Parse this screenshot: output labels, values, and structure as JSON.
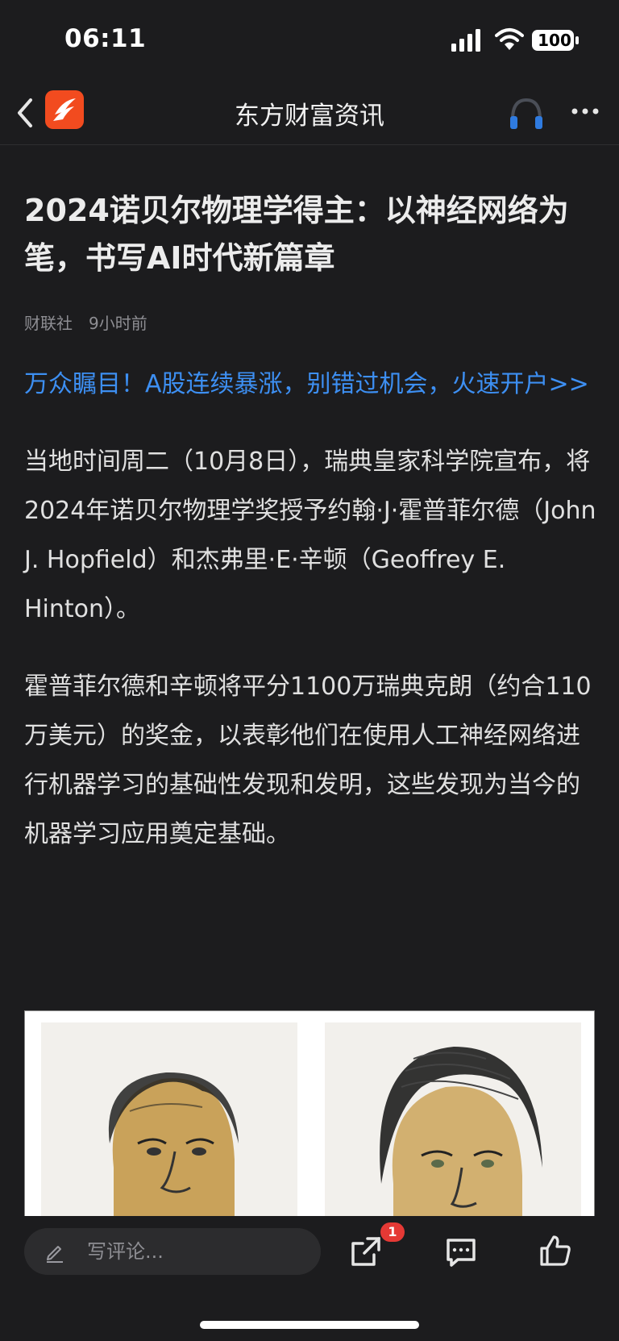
{
  "status_bar": {
    "time": "06:11",
    "battery": "100",
    "icons": [
      "signal-icon",
      "wifi-icon",
      "battery-icon"
    ]
  },
  "nav": {
    "title": "东方财富资讯",
    "icons": [
      "back-icon",
      "app-logo-icon",
      "headset-icon",
      "more-icon"
    ]
  },
  "article": {
    "title": "2024诺贝尔物理学得主：以神经网络为笔，书写AI时代新篇章",
    "source": "财联社",
    "time": "9小时前",
    "promo": "万众瞩目！A股连续暴涨，别错过机会，火速开户>>",
    "paragraphs": [
      "当地时间周二（10月8日），瑞典皇家科学院宣布，将2024年诺贝尔物理学奖授予约翰·J·霍普菲尔德（John J. Hopfield）和杰弗里·E·辛顿（Geoffrey E. Hinton）。",
      "霍普菲尔德和辛顿将平分1100万瑞典克朗（约合110万美元）的奖金，以表彰他们在使用人工神经网络进行机器学习的基础性发现和发明，这些发现为当今的机器学习应用奠定基础。"
    ]
  },
  "bottom_bar": {
    "comment_placeholder": "写评论...",
    "share_badge": "1",
    "icons": [
      "pen-icon",
      "share-icon",
      "comment-icon",
      "like-icon"
    ]
  },
  "colors": {
    "background": "#1c1c1e",
    "link": "#3d8ff2",
    "logo": "#f24b1f",
    "badge": "#e53935"
  }
}
